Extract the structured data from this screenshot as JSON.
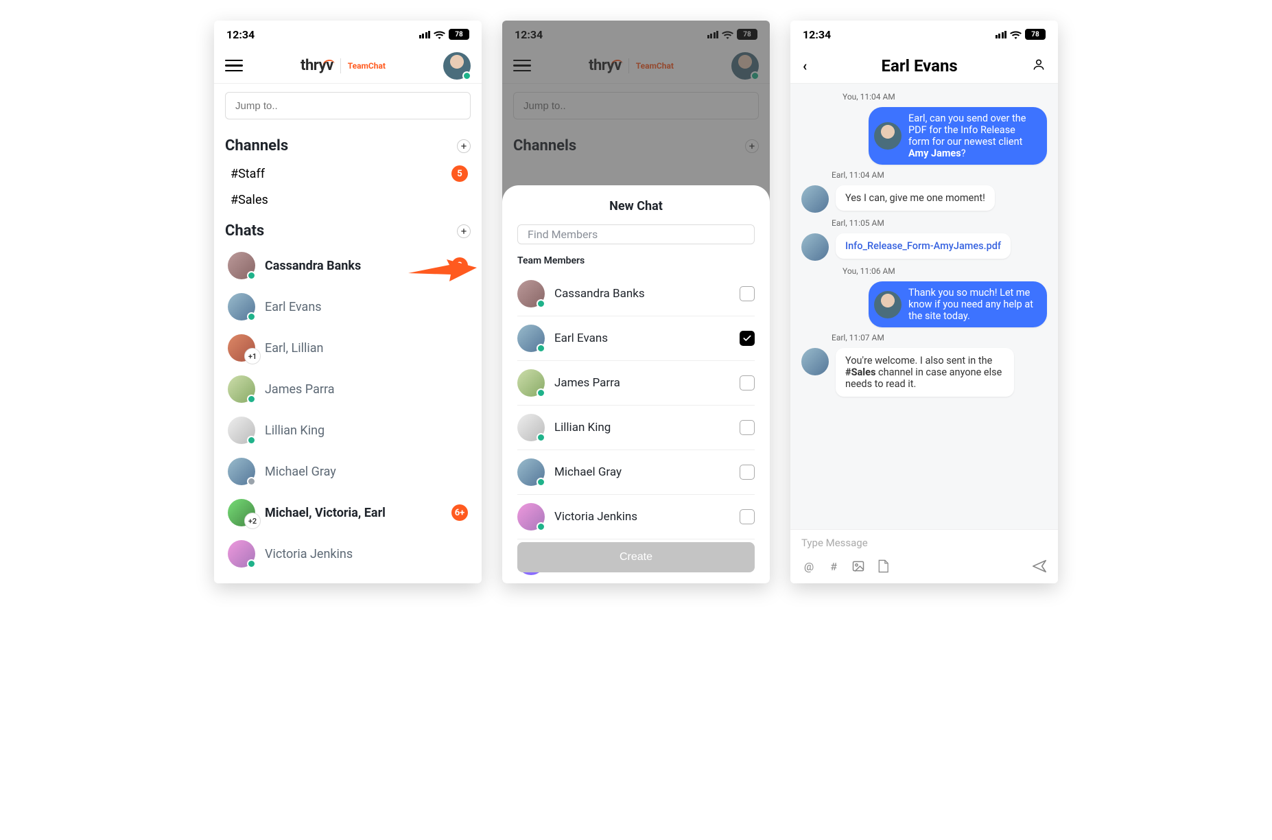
{
  "status": {
    "time": "12:34",
    "battery": "78"
  },
  "brand": {
    "name": "thryv",
    "sub": "TeamChat"
  },
  "search": {
    "placeholder": "Jump to.."
  },
  "sections": {
    "channels_title": "Channels",
    "chats_title": "Chats"
  },
  "channels": [
    {
      "name": "#Staff",
      "badge": "5"
    },
    {
      "name": "#Sales",
      "badge": ""
    }
  ],
  "chats": [
    {
      "name": "Cassandra Banks",
      "bold": true,
      "badge": "2",
      "stack": ""
    },
    {
      "name": "Earl Evans",
      "bold": false,
      "badge": "",
      "stack": ""
    },
    {
      "name": "Earl, Lillian",
      "bold": false,
      "badge": "",
      "stack": "+1"
    },
    {
      "name": "James Parra",
      "bold": false,
      "badge": "",
      "stack": ""
    },
    {
      "name": "Lillian King",
      "bold": false,
      "badge": "",
      "stack": ""
    },
    {
      "name": "Michael Gray",
      "bold": false,
      "badge": "",
      "stack": ""
    },
    {
      "name": "Michael, Victoria, Earl",
      "bold": true,
      "badge": "6+",
      "stack": "+2"
    },
    {
      "name": "Victoria Jenkins",
      "bold": false,
      "badge": "",
      "stack": ""
    }
  ],
  "newChat": {
    "title": "New Chat",
    "find_placeholder": "Find Members",
    "team_label": "Team Members",
    "members": [
      {
        "name": "Cassandra Banks",
        "checked": false
      },
      {
        "name": "Earl Evans",
        "checked": true
      },
      {
        "name": "James Parra",
        "checked": false
      },
      {
        "name": "Lillian King",
        "checked": false
      },
      {
        "name": "Michael Gray",
        "checked": false
      },
      {
        "name": "Victoria Jenkins",
        "checked": false
      }
    ],
    "create_label": "Create"
  },
  "conversation": {
    "title": "Earl Evans",
    "composer_placeholder": "Type Message",
    "messages": [
      {
        "meta": "You, 11:04 AM",
        "outgoing": true,
        "parts": [
          "Earl, can you send over the PDF for the Info Release form for our newest client ",
          {
            "b": "Amy James"
          },
          "?"
        ]
      },
      {
        "meta": "Earl, 11:04 AM",
        "outgoing": false,
        "text": "Yes I can, give me one moment!"
      },
      {
        "meta": "Earl, 11:05 AM",
        "outgoing": false,
        "link": "Info_Release_Form-AmyJames.pdf"
      },
      {
        "meta": "You, 11:06 AM",
        "outgoing": true,
        "text": "Thank you so much! Let me know if you need any help at the site today."
      },
      {
        "meta": "Earl, 11:07 AM",
        "outgoing": false,
        "parts": [
          "You're welcome. I also sent in the ",
          {
            "b": "#Sales"
          },
          " channel in case anyone else needs to read it."
        ]
      }
    ]
  },
  "colors": {
    "accent": "#ff5a1f",
    "primary_blue": "#3d73ff"
  }
}
